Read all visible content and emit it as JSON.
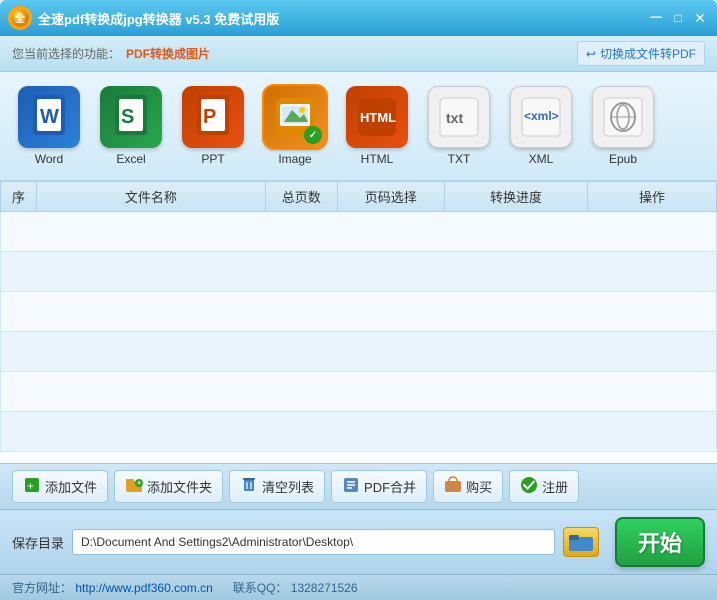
{
  "titlebar": {
    "logo_text": "●",
    "title": "全速pdf转换成jpg转换器 v5.3 免费试用版",
    "min_btn": "─",
    "max_btn": "□",
    "close_btn": "✕"
  },
  "toolbar": {
    "label": "您当前选择的功能：",
    "current_mode": "PDF转换成图片",
    "switch_btn": "切换成文件转PDF",
    "switch_arrow": "↩"
  },
  "formats": [
    {
      "id": "word",
      "label": "Word",
      "icon_text": "W",
      "style": "word",
      "selected": false
    },
    {
      "id": "excel",
      "label": "Excel",
      "icon_text": "S",
      "style": "excel",
      "selected": false
    },
    {
      "id": "ppt",
      "label": "PPT",
      "icon_text": "P",
      "style": "ppt",
      "selected": false
    },
    {
      "id": "image",
      "label": "Image",
      "icon_text": "🖼",
      "style": "image",
      "selected": true,
      "badge": "✓"
    },
    {
      "id": "html",
      "label": "HTML",
      "icon_text": "HTML",
      "style": "html",
      "selected": false
    },
    {
      "id": "txt",
      "label": "TXT",
      "icon_text": "txt",
      "style": "txt",
      "selected": false
    },
    {
      "id": "xml",
      "label": "XML",
      "icon_text": "xml▶",
      "style": "xml",
      "selected": false
    },
    {
      "id": "epub",
      "label": "Epub",
      "icon_text": "Ꝑ",
      "style": "epub",
      "selected": false
    }
  ],
  "table": {
    "columns": [
      "序",
      "文件名称",
      "总页数",
      "页码选择",
      "转换进度",
      "操作"
    ],
    "col_widths": [
      "5%",
      "30%",
      "10%",
      "15%",
      "20%",
      "20%"
    ],
    "rows": []
  },
  "buttons": [
    {
      "id": "add-file",
      "label": "添加文件",
      "icon": "📄"
    },
    {
      "id": "add-folder",
      "label": "添加文件夹",
      "icon": "📁"
    },
    {
      "id": "clear-list",
      "label": "清空列表",
      "icon": "🗑"
    },
    {
      "id": "pdf-merge",
      "label": "PDF合并",
      "icon": "📋"
    },
    {
      "id": "buy",
      "label": "购买",
      "icon": "🛒"
    },
    {
      "id": "register",
      "label": "注册",
      "icon": "✅"
    }
  ],
  "save_row": {
    "label": "保存目录",
    "path": "D:\\Document And Settings2\\Administrator\\Desktop\\",
    "folder_icon": "📂",
    "start_label": "开始"
  },
  "status_bar": {
    "website_label": "官方网址：",
    "website_url": "http://www.pdf360.com.cn",
    "contact_label": "联系QQ：",
    "contact_qq": "1328271526"
  }
}
